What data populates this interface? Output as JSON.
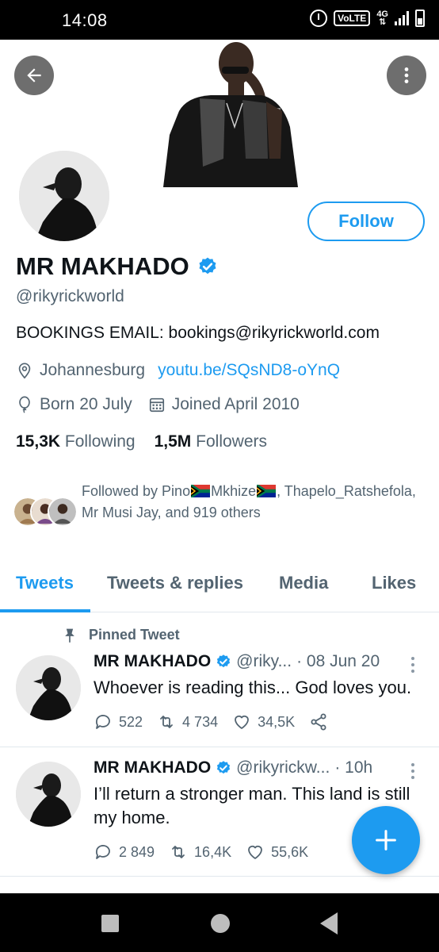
{
  "status_bar": {
    "time": "14:08",
    "volte": "VoLTE",
    "network": "4G"
  },
  "profile": {
    "name": "MR MAKHADO",
    "handle": "@rikyrickworld",
    "bio": "BOOKINGS EMAIL: bookings@rikyrickworld.com",
    "location": "Johannesburg",
    "website": "youtu.be/SQsND8-oYnQ",
    "born": "Born 20 July",
    "joined": "Joined April 2010",
    "following_count": "15,3K",
    "following_label": "Following",
    "followers_count": "1,5M",
    "followers_label": "Followers",
    "follow_button": "Follow",
    "followed_by_prefix": "Followed by Pino",
    "followed_by_name2": "Mkhize",
    "followed_by_rest": ", Thapelo_Ratshefola, Mr Musi Jay, and 919 others",
    "colors": {
      "accent": "#1d9bf0",
      "text_secondary": "#536471"
    }
  },
  "tabs": [
    {
      "label": "Tweets",
      "active": true
    },
    {
      "label": "Tweets & replies"
    },
    {
      "label": "Media"
    },
    {
      "label": "Likes"
    }
  ],
  "tweets": [
    {
      "pinned_label": "Pinned Tweet",
      "name": "MR MAKHADO",
      "handle": "@riky...",
      "date": "· 08 Jun 20",
      "text": "Whoever is reading this... God loves you.",
      "replies": "522",
      "retweets": "4 734",
      "likes": "34,5K"
    },
    {
      "name": "MR MAKHADO",
      "handle": "@rikyrickw...",
      "date": "· 10h",
      "text": "I’ll return a stronger man. This land is still my home.",
      "replies": "2 849",
      "retweets": "16,4K",
      "likes": "55,6K"
    }
  ],
  "icons": [
    "back-arrow-icon",
    "more-vertical-icon",
    "verified-badge-icon",
    "location-pin-icon",
    "balloon-icon",
    "calendar-icon",
    "pin-icon",
    "reply-icon",
    "retweet-icon",
    "like-icon",
    "share-icon",
    "compose-plus-icon"
  ]
}
